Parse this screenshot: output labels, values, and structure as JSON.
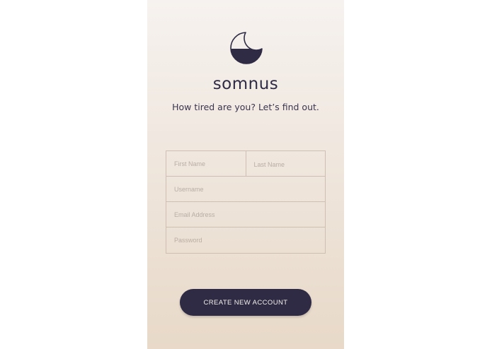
{
  "app": {
    "name": "somnus",
    "tagline": "How tired are you? Let’s find out."
  },
  "form": {
    "first_name_placeholder": "First Name",
    "last_name_placeholder": "Last Name",
    "username_placeholder": "Username",
    "email_placeholder": "Email Address",
    "password_placeholder": "Password"
  },
  "actions": {
    "create_account_label": "CREATE NEW ACCOUNT"
  },
  "colors": {
    "primary": "#2f2b45",
    "background_top": "#f6f2ef",
    "background_bottom": "#e8d9c8",
    "field_border": "#cdbfb1"
  },
  "icons": {
    "logo": "crescent-moon-icon"
  }
}
